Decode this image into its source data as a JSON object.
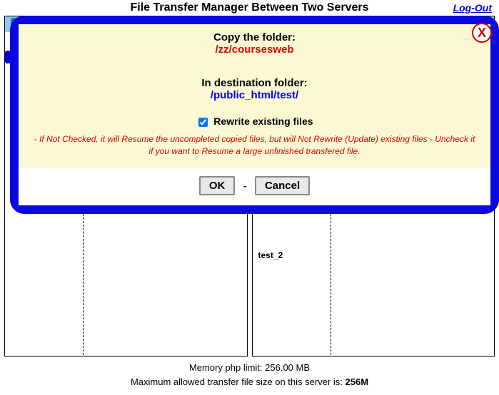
{
  "header": {
    "title": "File Transfer Manager Between Two Servers",
    "logout": "Log-Out"
  },
  "panel_right": {
    "item": "test_2"
  },
  "footer": {
    "line1": "Memory php limit: 256.00 MB",
    "line2_prefix": "Maximum allowed transfer file size on this server is: ",
    "line2_value": "256M"
  },
  "dialog": {
    "copy_label": "Copy the folder:",
    "source_path": "/zz/coursesweb",
    "dest_label": "In destination folder:",
    "dest_path": "/public_html/test/",
    "checkbox_label": "Rewrite existing files",
    "checkbox_checked": true,
    "hint": "- If Not Checked, it will Resume the uncompleted copied files, but will Not Rewrite (Update) existing files - Uncheck it if you want to Resume a large unfinished transfered file.",
    "ok": "OK",
    "cancel": "Cancel",
    "close": "X",
    "dash": "-"
  }
}
